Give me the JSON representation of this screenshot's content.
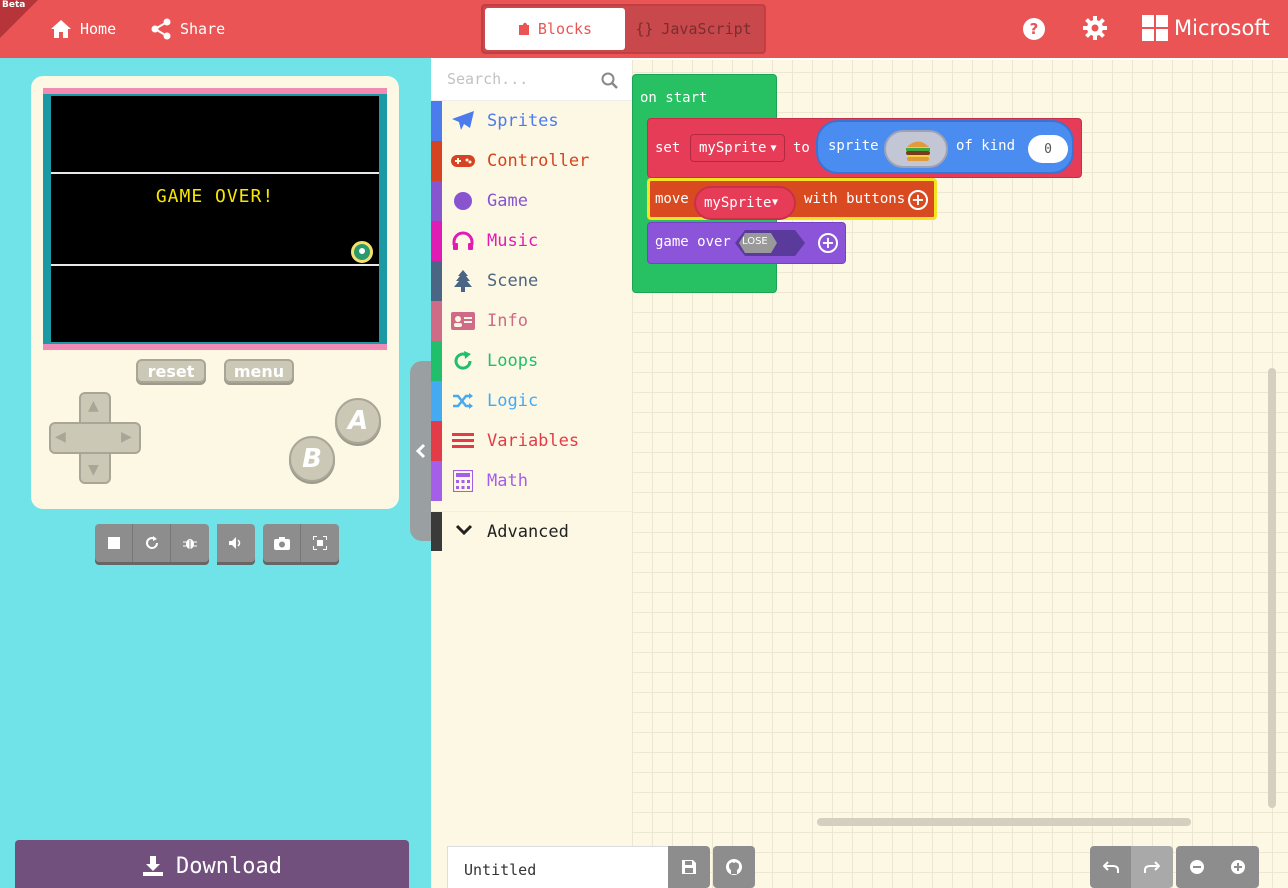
{
  "header": {
    "beta_badge": "Beta",
    "home_label": "Home",
    "share_label": "Share",
    "tab_blocks": "Blocks",
    "tab_javascript": "JavaScript",
    "brand": "Microsoft",
    "accent_color": "#ea5455"
  },
  "simulator": {
    "screen_message": "GAME OVER!",
    "reset_label": "reset",
    "menu_label": "menu",
    "button_a": "A",
    "button_b": "B",
    "toolbar_icons": [
      "stop-icon",
      "restart-icon",
      "debug-icon",
      "volume-icon",
      "screenshot-icon",
      "fullscreen-icon"
    ],
    "download_label": "Download"
  },
  "toolbox": {
    "search_placeholder": "Search...",
    "categories": [
      {
        "label": "Sprites",
        "color": "#4b7bec",
        "icon": "paper-plane-icon"
      },
      {
        "label": "Controller",
        "color": "#d54322",
        "icon": "gamepad-icon"
      },
      {
        "label": "Game",
        "color": "#8854d0",
        "icon": "circle-icon"
      },
      {
        "label": "Music",
        "color": "#e11cb5",
        "icon": "headphones-icon"
      },
      {
        "label": "Scene",
        "color": "#4b6584",
        "icon": "tree-icon"
      },
      {
        "label": "Info",
        "color": "#cf6a87",
        "icon": "id-card-icon"
      },
      {
        "label": "Loops",
        "color": "#20bf6b",
        "icon": "refresh-icon"
      },
      {
        "label": "Logic",
        "color": "#45aaf2",
        "icon": "shuffle-icon"
      },
      {
        "label": "Variables",
        "color": "#e33c48",
        "icon": "list-icon"
      },
      {
        "label": "Math",
        "color": "#a55eea",
        "icon": "calculator-icon"
      }
    ],
    "advanced_label": "Advanced"
  },
  "workspace": {
    "on_start": "on start",
    "set_kw": "set",
    "variable": "mySprite",
    "to_kw": "to",
    "sprite_kw": "sprite",
    "of_kind_kw": "of kind",
    "kind_value": "0",
    "move_kw": "move",
    "with_buttons_kw": "with buttons",
    "game_over_kw": "game over",
    "lose_label": "LOSE"
  },
  "footer": {
    "project_name": "Untitled"
  }
}
